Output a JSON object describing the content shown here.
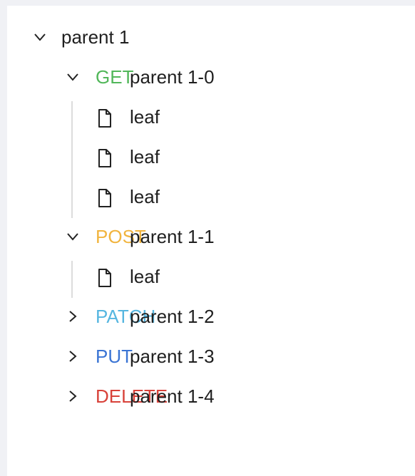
{
  "tree": {
    "root": {
      "label": "parent 1",
      "icon": "chevron-down-icon",
      "expanded": true
    },
    "children": [
      {
        "method": "GET",
        "method_color": "#52b75a",
        "label": "parent 1-0",
        "icon": "chevron-down-icon",
        "expanded": true,
        "leaves": [
          "leaf",
          "leaf",
          "leaf"
        ]
      },
      {
        "method": "POST",
        "method_color": "#f1b43e",
        "label": "parent 1-1",
        "icon": "chevron-down-icon",
        "expanded": true,
        "leaves": [
          "leaf"
        ]
      },
      {
        "method": "PATCH",
        "method_color": "#56b6e0",
        "label": "parent 1-2",
        "icon": "chevron-right-icon",
        "expanded": false
      },
      {
        "method": "PUT",
        "method_color": "#3a74d4",
        "label": "parent 1-3",
        "icon": "chevron-right-icon",
        "expanded": false
      },
      {
        "method": "DELETE",
        "method_color": "#d8423a",
        "label": "parent 1-4",
        "icon": "chevron-right-icon",
        "expanded": false
      }
    ],
    "leaf_icon": "file-icon"
  }
}
